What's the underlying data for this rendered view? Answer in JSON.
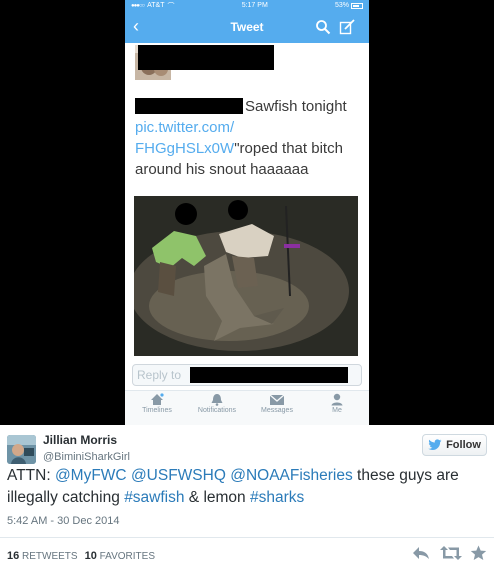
{
  "phone_screenshot": {
    "status_bar": {
      "carrier": "AT&T",
      "time": "5:17 PM",
      "battery": "53%"
    },
    "nav": {
      "title": "Tweet",
      "back_icon": "chevron-left-icon",
      "search_icon": "search-icon",
      "compose_icon": "compose-icon"
    },
    "tweet": {
      "line1_text": "Sawfish tonight",
      "link_line1": "pic.twitter.com/",
      "link_line2": "FHGgHSLx0W",
      "line3_text": "\"roped that bitch",
      "line4_text": "around his snout haaaaaa"
    },
    "reply_placeholder": "Reply to",
    "tabs": [
      {
        "label": "Timelines",
        "icon": "home-icon"
      },
      {
        "label": "Notifications",
        "icon": "bell-icon"
      },
      {
        "label": "Messages",
        "icon": "envelope-icon"
      },
      {
        "label": "Me",
        "icon": "person-icon"
      }
    ]
  },
  "card": {
    "author_name": "Jillian Morris",
    "author_handle": "@BiminiSharkGirl",
    "follow_label": "Follow",
    "text": {
      "prefix": "ATTN: ",
      "mention1": "@MyFWC",
      "mention2": "@USFWSHQ",
      "mention3": "@NOAAFisheries",
      "middle1": " these guys are",
      "line2_start": "illegally catching ",
      "hashtag1": "#sawfish",
      "middle2": " & lemon ",
      "hashtag2": "#sharks"
    },
    "timestamp": "5:42 AM - 30 Dec 2014",
    "retweets_count": "16",
    "retweets_label": "RETWEETS",
    "favorites_count": "10",
    "favorites_label": "FAVORITES",
    "actions": [
      "reply-icon",
      "retweet-icon",
      "favorite-icon"
    ]
  },
  "colors": {
    "twitter_blue": "#55acee",
    "link_blue": "#2b7bb9",
    "text_dark": "#292f33",
    "text_gray": "#66757f"
  }
}
